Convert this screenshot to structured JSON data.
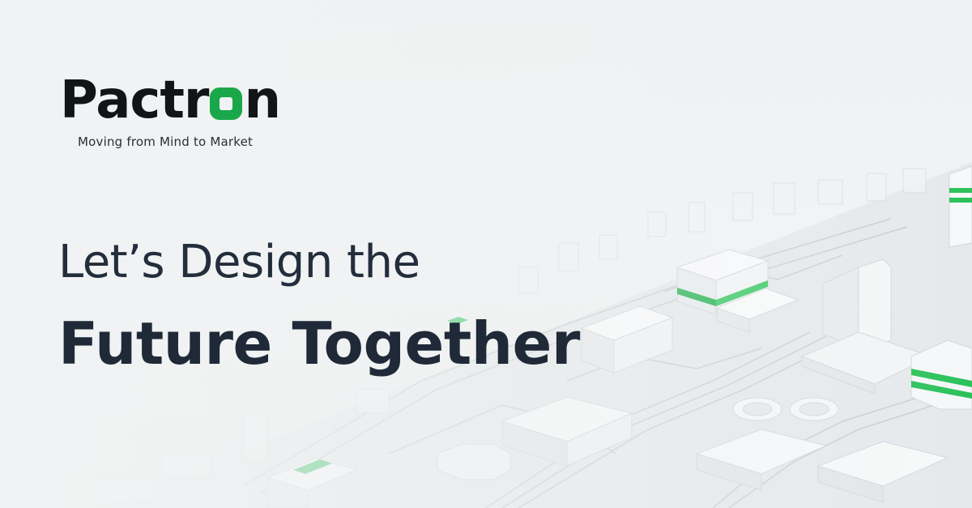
{
  "brand": {
    "logo_text_before": "Pactr",
    "logo_text_after": "n",
    "logo_full": "Pactron",
    "tagline": "Moving from Mind to Market",
    "accent_color": "#1aa74a"
  },
  "headline": {
    "line1": "Let’s Design the",
    "line2": "Future Together",
    "text_color": "#232d3c"
  },
  "background": {
    "description_icon": "isometric-city-circuit-illustration"
  }
}
